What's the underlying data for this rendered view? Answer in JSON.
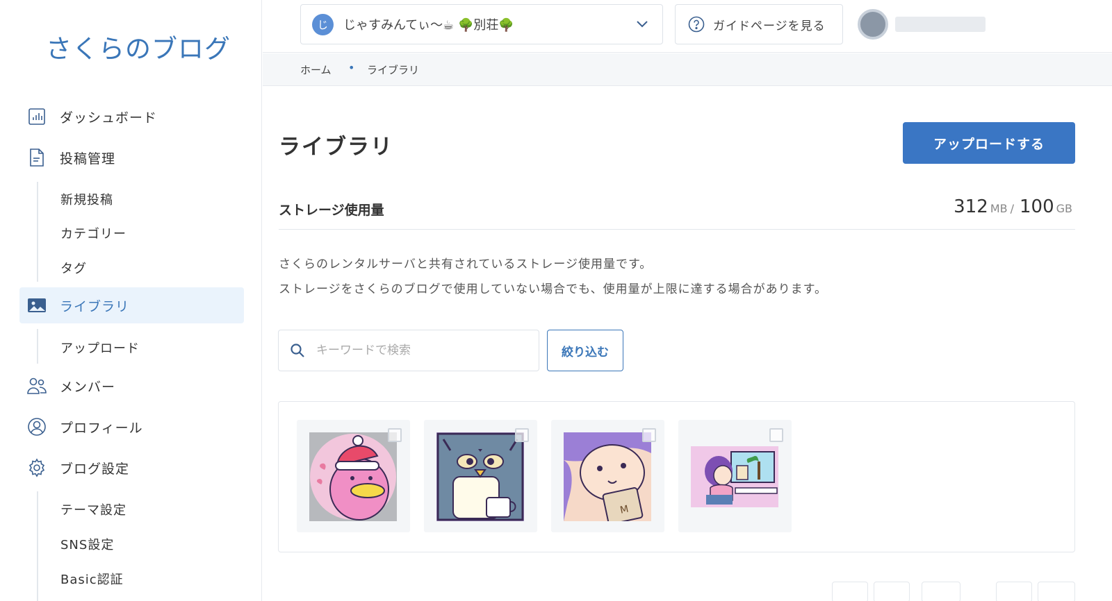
{
  "sidebar": {
    "logo": "さくらのブログ",
    "items": [
      {
        "label": "ダッシュボード",
        "icon": "chart-icon"
      },
      {
        "label": "投稿管理",
        "icon": "document-icon"
      },
      {
        "label": "新規投稿"
      },
      {
        "label": "カテゴリー"
      },
      {
        "label": "タグ"
      },
      {
        "label": "ライブラリ",
        "icon": "image-icon",
        "active": true
      },
      {
        "label": "アップロード"
      },
      {
        "label": "メンバー",
        "icon": "users-icon"
      },
      {
        "label": "プロフィール",
        "icon": "user-circle-icon"
      },
      {
        "label": "ブログ設定",
        "icon": "gear-icon"
      },
      {
        "label": "テーマ設定"
      },
      {
        "label": "SNS設定"
      },
      {
        "label": "Basic認証"
      }
    ]
  },
  "topbar": {
    "blog_initial": "じ",
    "blog_name": "じゃすみんてぃ〜☕ 🌳別荘🌳",
    "guide_label": "ガイドページを見る"
  },
  "breadcrumb": {
    "home": "ホーム",
    "current": "ライブラリ"
  },
  "main": {
    "title": "ライブラリ",
    "upload_button": "アップロードする",
    "storage": {
      "label": "ストレージ使用量",
      "used": "312",
      "used_unit": "MB",
      "separator": "/",
      "total": "100",
      "total_unit": "GB"
    },
    "description": [
      "さくらのレンタルサーバと共有されているストレージ使用量です。",
      "ストレージをさくらのブログで使用していない場合でも、使用量が上限に達する場合があります。"
    ],
    "search_placeholder": "キーワードで検索",
    "filter_button": "絞り込む"
  },
  "colors": {
    "accent": "#3a76c4",
    "active_bg": "#eaf3fc"
  }
}
